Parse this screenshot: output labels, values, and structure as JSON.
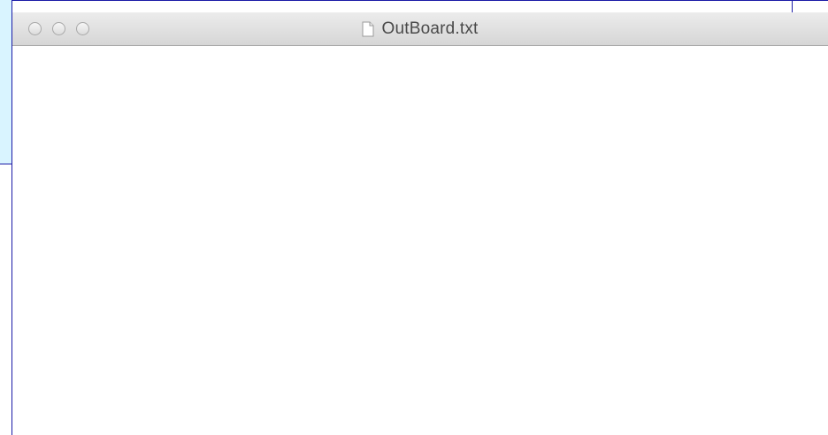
{
  "window": {
    "title": "OutBoard.txt",
    "file_icon": "document-icon",
    "controls": [
      "close-button",
      "minimize-button",
      "zoom-button"
    ]
  },
  "editor": {
    "text": ""
  },
  "colors": {
    "background_panel": "#d9f4ff",
    "panel_border": "#1a1aa6",
    "titlebar_top": "#ececec",
    "titlebar_bottom": "#d6d6d6",
    "title_text": "#4a4a4a"
  }
}
